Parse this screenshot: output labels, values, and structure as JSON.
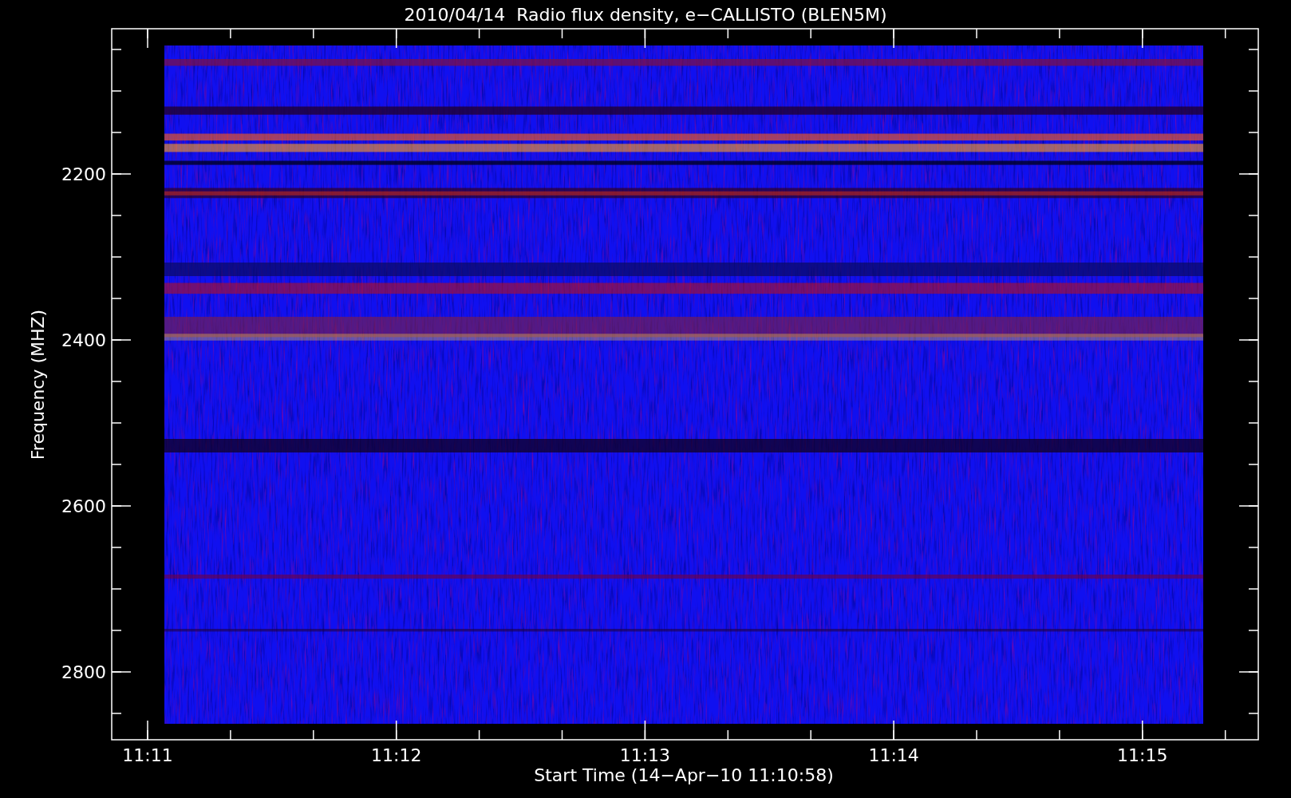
{
  "title": "2010/04/14  Radio flux density, e−CALLISTO (BLEN5M)",
  "y_axis": {
    "label": "Frequency (MHZ)",
    "ticks": [
      "2200",
      "2400",
      "2600",
      "2800"
    ]
  },
  "x_axis": {
    "label": "Start Time (14−Apr−10 11:10:58)",
    "ticks": [
      "11:11",
      "11:12",
      "11:13",
      "11:14",
      "11:15"
    ]
  }
}
